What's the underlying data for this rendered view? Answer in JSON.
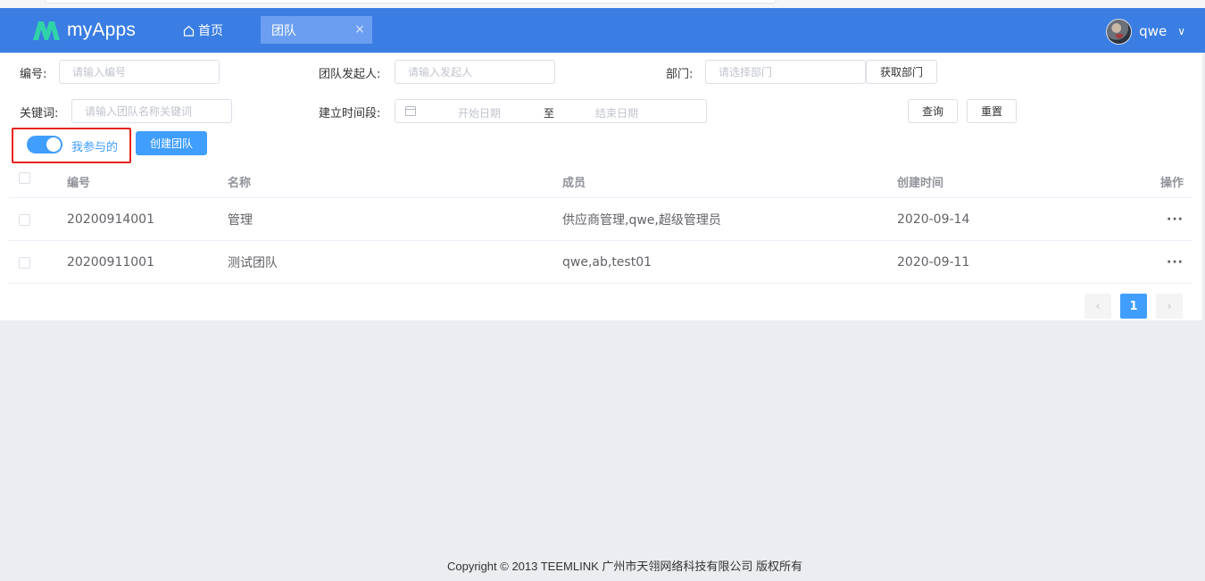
{
  "app": {
    "logo_text": "myApps"
  },
  "nav": {
    "home_label": "首页",
    "active_tab_label": "团队",
    "tab_close": "×"
  },
  "user": {
    "name": "qwe",
    "chevron": "∨"
  },
  "filters": {
    "number_label": "编号:",
    "number_placeholder": "请输入编号",
    "initiator_label": "团队发起人:",
    "initiator_placeholder": "请输入发起人",
    "dept_label": "部门:",
    "dept_placeholder": "请选择部门",
    "get_dept_button": "获取部门",
    "keyword_label": "关键词:",
    "keyword_placeholder": "请输入团队名称关键词",
    "period_label": "建立时间段:",
    "start_placeholder": "开始日期",
    "range_sep": "至",
    "end_placeholder": "结束日期",
    "query_button": "查询",
    "reset_button": "重置"
  },
  "toggle": {
    "label": "我参与的",
    "on": true
  },
  "actions": {
    "create_team_button": "创建团队"
  },
  "table": {
    "headers": {
      "id": "编号",
      "name": "名称",
      "members": "成员",
      "created": "创建时间",
      "ops": "操作"
    },
    "rows": [
      {
        "id": "20200914001",
        "name": "管理",
        "members": "供应商管理,qwe,超级管理员",
        "created": "2020-09-14",
        "more": "···"
      },
      {
        "id": "20200911001",
        "name": "测试团队",
        "members": "qwe,ab,test01",
        "created": "2020-09-11",
        "more": "···"
      }
    ]
  },
  "pager": {
    "prev": "‹",
    "current": "1",
    "next": "›"
  },
  "footer": {
    "text": "Copyright © 2013 TEEMLINK 广州市天翎网络科技有限公司 版权所有"
  },
  "colors": {
    "header_bg": "#3a7de3",
    "primary": "#409eff",
    "highlight_border": "#e8231f"
  }
}
